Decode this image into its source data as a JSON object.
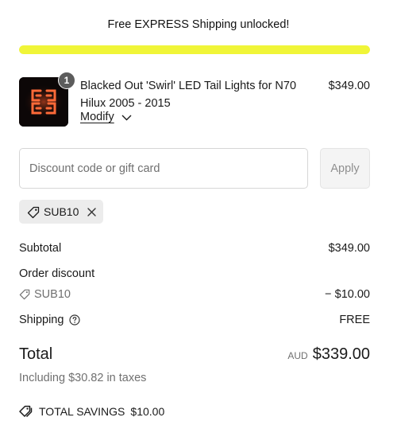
{
  "shipping_banner": {
    "text": "Free EXPRESS Shipping unlocked!",
    "progress_percent": 100,
    "bar_color": "#f0f538"
  },
  "line_item": {
    "quantity": "1",
    "name": "Blacked Out 'Swirl' LED Tail Lights for N70 Hilux 2005 - 2015",
    "price": "$349.00",
    "modify_label": "Modify"
  },
  "discount": {
    "placeholder": "Discount code or gift card",
    "value": "",
    "apply_label": "Apply",
    "applied_code": "SUB10"
  },
  "summary": {
    "subtotal_label": "Subtotal",
    "subtotal_value": "$349.00",
    "order_discount_label": "Order discount",
    "discount_code": "SUB10",
    "discount_value": "− $10.00",
    "shipping_label": "Shipping",
    "shipping_value": "FREE"
  },
  "total": {
    "label": "Total",
    "currency": "AUD",
    "amount": "$339.00",
    "taxes_note": "Including $30.82 in taxes"
  },
  "savings": {
    "label": "TOTAL SAVINGS",
    "amount": "$10.00"
  },
  "icons": {
    "tag": "tag-icon",
    "close": "close-icon",
    "chevron": "chevron-down-icon",
    "help": "question-circle-icon",
    "savings": "tags-icon"
  }
}
